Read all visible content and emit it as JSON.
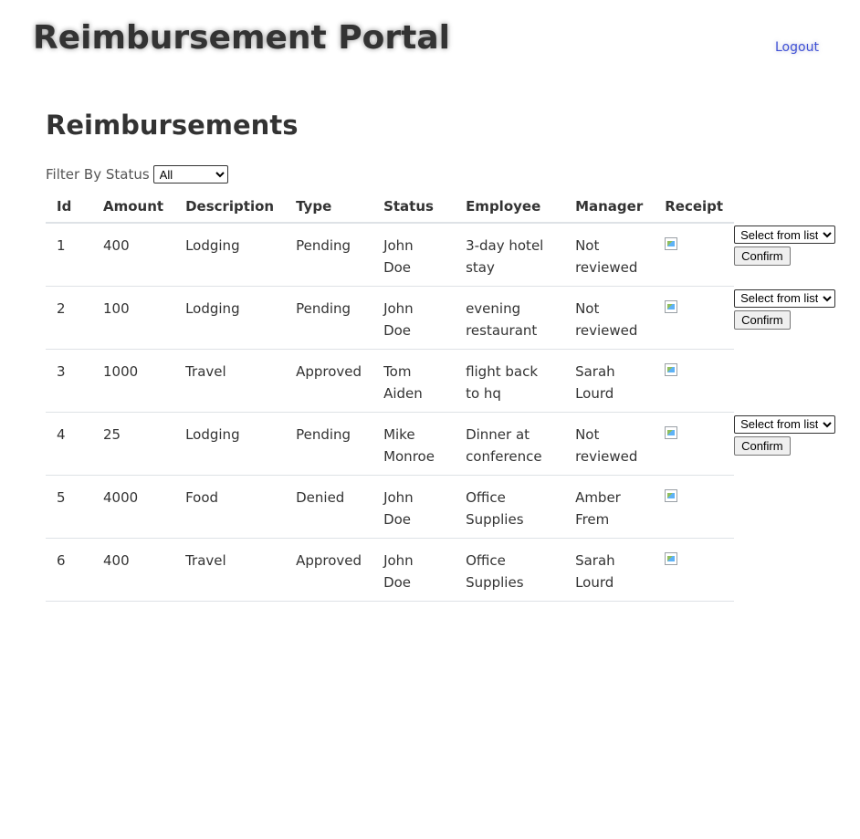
{
  "header": {
    "app_title": "Reimbursement Portal",
    "logout_label": "Logout"
  },
  "main": {
    "page_title": "Reimbursements",
    "filter": {
      "label": "Filter By Status",
      "selected": "All"
    },
    "table": {
      "columns": [
        "Id",
        "Amount",
        "Description",
        "Type",
        "Status",
        "Employee",
        "Manager",
        "Receipt"
      ],
      "rows": [
        {
          "id": "1",
          "amount": "400",
          "description": "Lodging",
          "type": "Pending",
          "status": "John Doe",
          "employee": "3-day hotel stay",
          "manager": "Not reviewed",
          "has_actions": true
        },
        {
          "id": "2",
          "amount": "100",
          "description": "Lodging",
          "type": "Pending",
          "status": "John Doe",
          "employee": "evening restaurant",
          "manager": "Not reviewed",
          "has_actions": true
        },
        {
          "id": "3",
          "amount": "1000",
          "description": "Travel",
          "type": "Approved",
          "status": "Tom Aiden",
          "employee": "flight back to hq",
          "manager": "Sarah Lourd",
          "has_actions": false
        },
        {
          "id": "4",
          "amount": "25",
          "description": "Lodging",
          "type": "Pending",
          "status": "Mike Monroe",
          "employee": "Dinner at conference",
          "manager": "Not reviewed",
          "has_actions": true
        },
        {
          "id": "5",
          "amount": "4000",
          "description": "Food",
          "type": "Denied",
          "status": "John Doe",
          "employee": "Office Supplies",
          "manager": "Amber Frem",
          "has_actions": false
        },
        {
          "id": "6",
          "amount": "400",
          "description": "Travel",
          "type": "Approved",
          "status": "John Doe",
          "employee": "Office Supplies",
          "manager": "Sarah Lourd",
          "has_actions": false
        }
      ],
      "receipt_icon": "broken-image-icon",
      "action_select_label": "Select from list",
      "confirm_label": "Confirm"
    }
  },
  "colors": {
    "text": "#333333",
    "link": "#3f51d6",
    "row_border": "#dee2e6"
  }
}
